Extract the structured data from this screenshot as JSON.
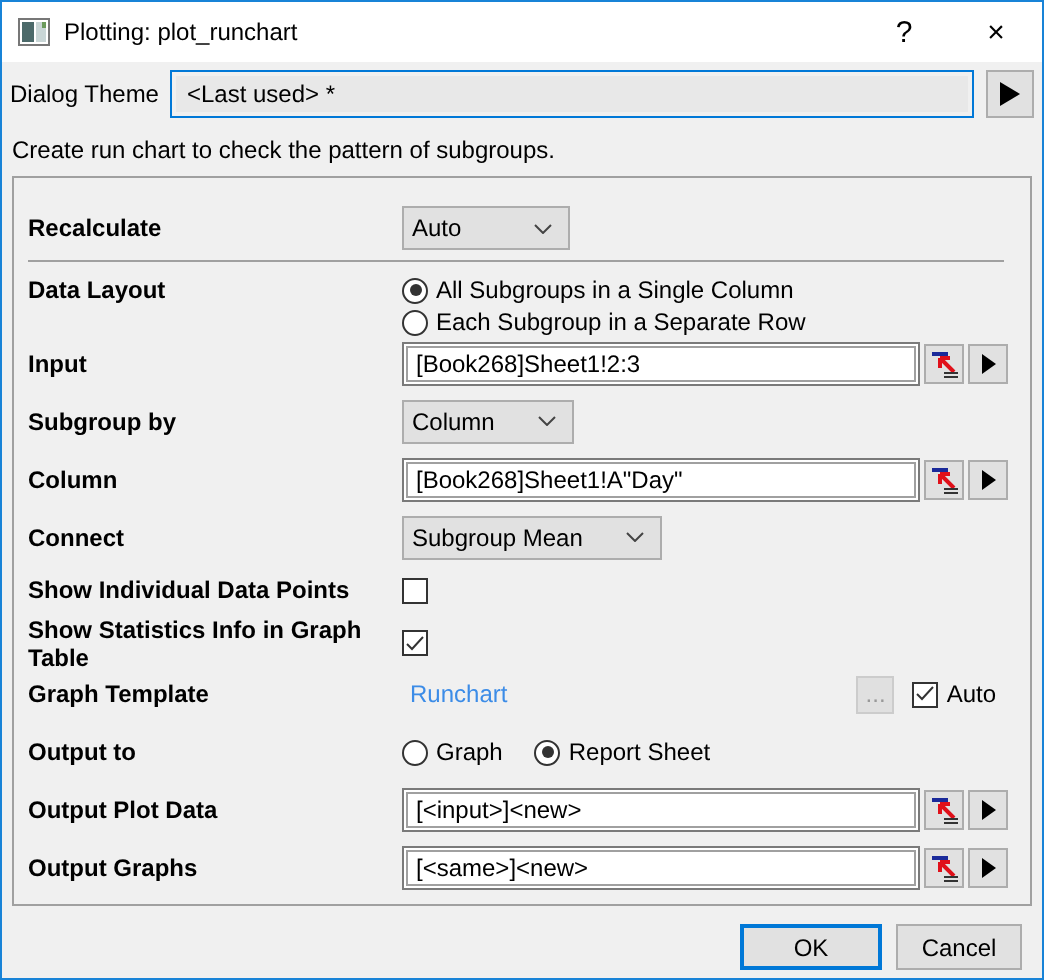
{
  "window": {
    "title": "Plotting: plot_runchart",
    "help": "?",
    "close": "×"
  },
  "theme": {
    "label": "Dialog Theme",
    "value": "<Last used> *"
  },
  "description": "Create run chart to check the pattern of subgroups.",
  "recalculate": {
    "label": "Recalculate",
    "value": "Auto"
  },
  "rows": [
    {
      "kind": "radio-stack",
      "label": "Data Layout",
      "options": [
        {
          "label": "All Subgroups in a Single Column",
          "selected": true
        },
        {
          "label": "Each Subgroup in a Separate Row",
          "selected": false
        }
      ]
    },
    {
      "kind": "range",
      "label": "Input",
      "value": "[Book268]Sheet1!2:3"
    },
    {
      "kind": "dropdown",
      "label": "Subgroup by",
      "value": "Column"
    },
    {
      "kind": "range",
      "label": "Column",
      "value": "[Book268]Sheet1!A\"Day\""
    },
    {
      "kind": "dropdown",
      "label": "Connect",
      "value": "Subgroup Mean"
    },
    {
      "kind": "checkbox",
      "label": "Show Individual Data Points",
      "checked": false
    },
    {
      "kind": "checkbox",
      "label": "Show Statistics Info in Graph Table",
      "checked": true
    },
    {
      "kind": "template",
      "label": "Graph Template",
      "link": "Runchart",
      "browse": "...",
      "browse_disabled": true,
      "auto": {
        "label": "Auto",
        "checked": true
      }
    },
    {
      "kind": "radio-row",
      "label": "Output to",
      "options": [
        {
          "label": "Graph",
          "selected": false
        },
        {
          "label": "Report Sheet",
          "selected": true
        }
      ]
    },
    {
      "kind": "range",
      "label": "Output Plot Data",
      "value": "[<input>]<new>"
    },
    {
      "kind": "range",
      "label": "Output Graphs",
      "value": "[<same>]<new>"
    }
  ],
  "buttons": [
    {
      "label": "OK",
      "default": true
    },
    {
      "label": "Cancel",
      "default": false
    }
  ]
}
